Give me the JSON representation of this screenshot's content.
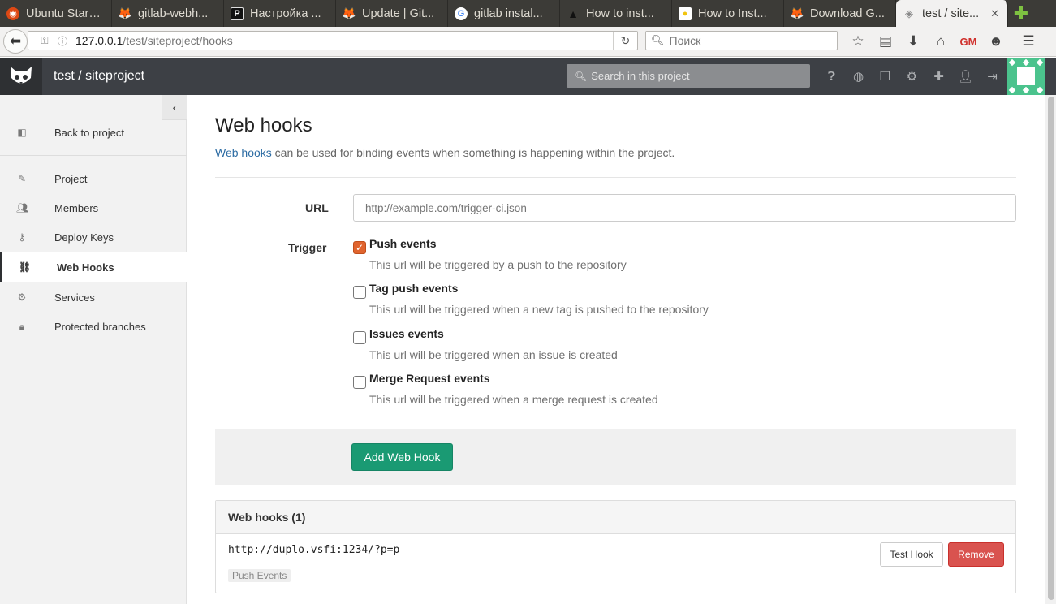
{
  "browser": {
    "tabs": [
      {
        "title": "Ubuntu Start P...",
        "icon": "ubuntu-icon",
        "color": "#dd4814"
      },
      {
        "title": "gitlab-webh...",
        "icon": "gitlab-icon",
        "color": "#e24329"
      },
      {
        "title": "Настройка ...",
        "icon": "p-icon",
        "color": "#111111"
      },
      {
        "title": "Update | Git...",
        "icon": "gitlab-icon",
        "color": "#e24329"
      },
      {
        "title": "gitlab instal...",
        "icon": "google-icon",
        "color": "#4285f4"
      },
      {
        "title": "How to inst...",
        "icon": "triangle-icon",
        "color": "#222222"
      },
      {
        "title": "How to Inst...",
        "icon": "lightbulb-icon",
        "color": "#f1c40f"
      },
      {
        "title": "Download G...",
        "icon": "gitlab-icon",
        "color": "#e24329"
      },
      {
        "title": "test / site...",
        "icon": "gitlab-cat-icon",
        "color": "#999999",
        "active": true
      }
    ],
    "url": {
      "host": "127.0.0.1",
      "path": "/test/siteproject/hooks"
    },
    "search_placeholder": "Поиск"
  },
  "header": {
    "project_title": "test / siteproject",
    "search_placeholder": "Search in this project"
  },
  "sidebar": {
    "back_label": "Back to project",
    "items": [
      {
        "label": "Project",
        "icon": "edit-icon"
      },
      {
        "label": "Members",
        "icon": "users-icon"
      },
      {
        "label": "Deploy Keys",
        "icon": "key-icon"
      },
      {
        "label": "Web Hooks",
        "icon": "link-icon",
        "active": true
      },
      {
        "label": "Services",
        "icon": "cogs-icon"
      },
      {
        "label": "Protected branches",
        "icon": "lock-icon"
      }
    ]
  },
  "main": {
    "title": "Web hooks",
    "description_link": "Web hooks",
    "description_rest": " can be used for binding events when something is happening within the project.",
    "url_label": "URL",
    "url_placeholder": "http://example.com/trigger-ci.json",
    "trigger_label": "Trigger",
    "triggers": [
      {
        "name": "Push events",
        "help": "This url will be triggered by a push to the repository",
        "checked": true
      },
      {
        "name": "Tag push events",
        "help": "This url will be triggered when a new tag is pushed to the repository",
        "checked": false
      },
      {
        "name": "Issues events",
        "help": "This url will be triggered when an issue is created",
        "checked": false
      },
      {
        "name": "Merge Request events",
        "help": "This url will be triggered when a merge request is created",
        "checked": false
      }
    ],
    "add_button": "Add Web Hook",
    "hooks_heading": "Web hooks (1)",
    "hooks": [
      {
        "url": "http://duplo.vsfi:1234/?p=p",
        "events": "Push Events",
        "test_label": "Test Hook",
        "remove_label": "Remove"
      }
    ]
  },
  "colors": {
    "header_bg": "#3d4045",
    "accent_green": "#1a9a73",
    "remove_red": "#d9534f",
    "checkbox_orange": "#e0642e",
    "avatar_green": "#4bc38d"
  }
}
